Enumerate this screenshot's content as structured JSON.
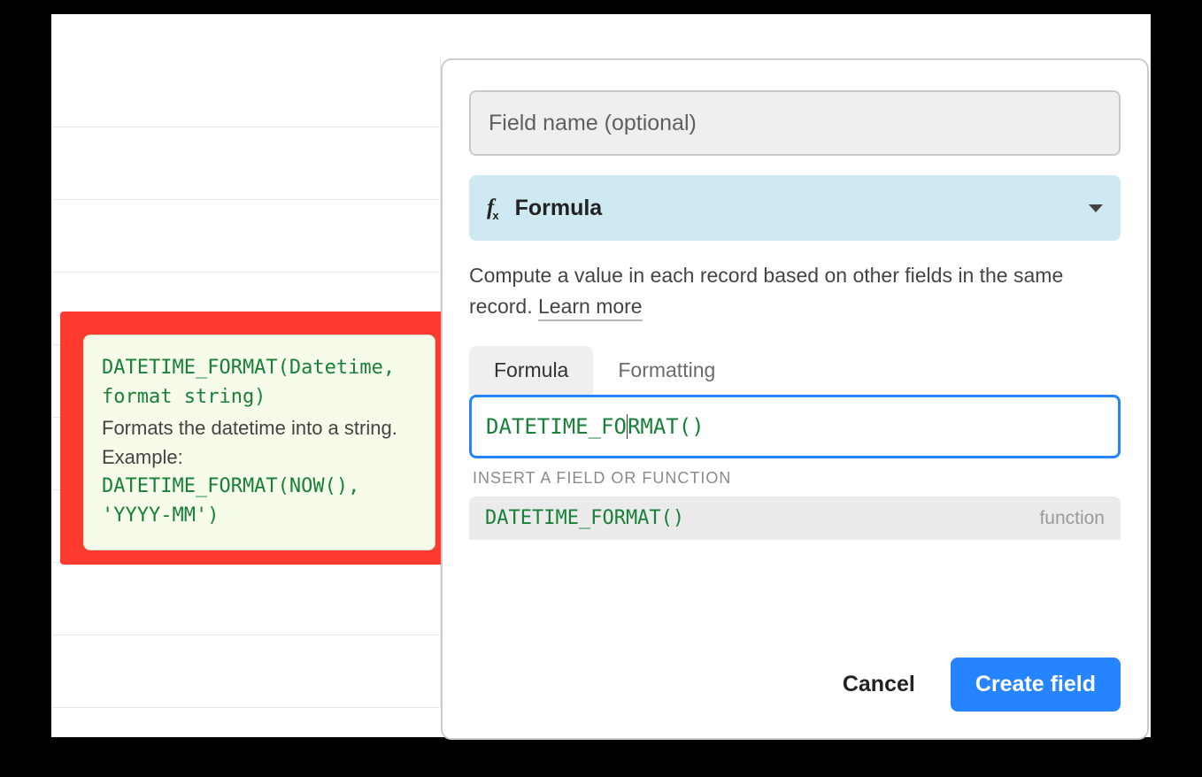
{
  "tooltip": {
    "signature": "DATETIME_FORMAT(Datetime, format string)",
    "description": "Formats the datetime into a string. Example:",
    "example": "DATETIME_FORMAT(NOW(), 'YYYY-MM')"
  },
  "panel": {
    "field_name_placeholder": "Field name (optional)",
    "field_name_value": "",
    "type_label": "Formula",
    "description_text": "Compute a value in each record based on other fields in the same record. ",
    "learn_more": "Learn more",
    "tabs": {
      "formula": "Formula",
      "formatting": "Formatting"
    },
    "formula_before": "DATETIME_FO",
    "formula_after": "RMAT()",
    "suggest_label": "INSERT A FIELD OR FUNCTION",
    "suggestions": [
      {
        "name": "DATETIME_FORMAT()",
        "kind": "function"
      }
    ],
    "cancel": "Cancel",
    "create": "Create field"
  }
}
